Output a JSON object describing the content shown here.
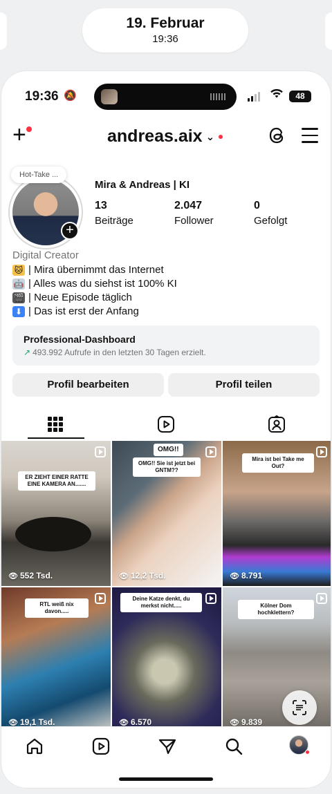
{
  "lockscreen": {
    "date": "19. Februar",
    "time": "19:36"
  },
  "status_bar": {
    "time": "19:36",
    "battery": "48"
  },
  "header": {
    "username": "andreas.aix"
  },
  "profile": {
    "note": "Hot-Take ...",
    "display_name": "Mira & Andreas | KI",
    "stats": [
      {
        "value": "13",
        "label": "Beiträge"
      },
      {
        "value": "2.047",
        "label": "Follower"
      },
      {
        "value": "0",
        "label": "Gefolgt"
      }
    ],
    "category": "Digital Creator",
    "bio": [
      {
        "icon": "cat-emoji",
        "text": "| Mira übernimmt das Internet"
      },
      {
        "icon": "robot-emoji",
        "text": "| Alles was du siehst ist 100% KI"
      },
      {
        "icon": "clapper-emoji",
        "text": "| Neue Episode täglich"
      },
      {
        "icon": "down-arrow-emoji",
        "text": "| Das ist erst der Anfang"
      }
    ]
  },
  "dashboard": {
    "title": "Professional-Dashboard",
    "subtitle": "493.992 Aufrufe in den letzten 30 Tagen erzielt."
  },
  "buttons": {
    "edit": "Profil bearbeiten",
    "share": "Profil teilen"
  },
  "tabs": [
    "grid-icon",
    "reels-icon",
    "tagged-icon"
  ],
  "posts": [
    {
      "caption": "ER ZIEHT EINER RATTE EINE KAMERA AN.......",
      "views": "552 Tsd."
    },
    {
      "caption": "OMG!! Sie ist jetzt bei GNTM??",
      "views": "12,2 Tsd."
    },
    {
      "caption": "Mira ist bei Take me Out?",
      "views": "8.791"
    },
    {
      "caption": "RTL weiß nix davon.....",
      "views": "19,1 Tsd."
    },
    {
      "caption": "Deine Katze denkt, du merkst nicht.....",
      "views": "6.570"
    },
    {
      "caption": "Kölner Dom hochklettern?",
      "views": "9.839"
    }
  ],
  "colors": {
    "notification": "#ff3040",
    "growth": "#1ea36b"
  }
}
